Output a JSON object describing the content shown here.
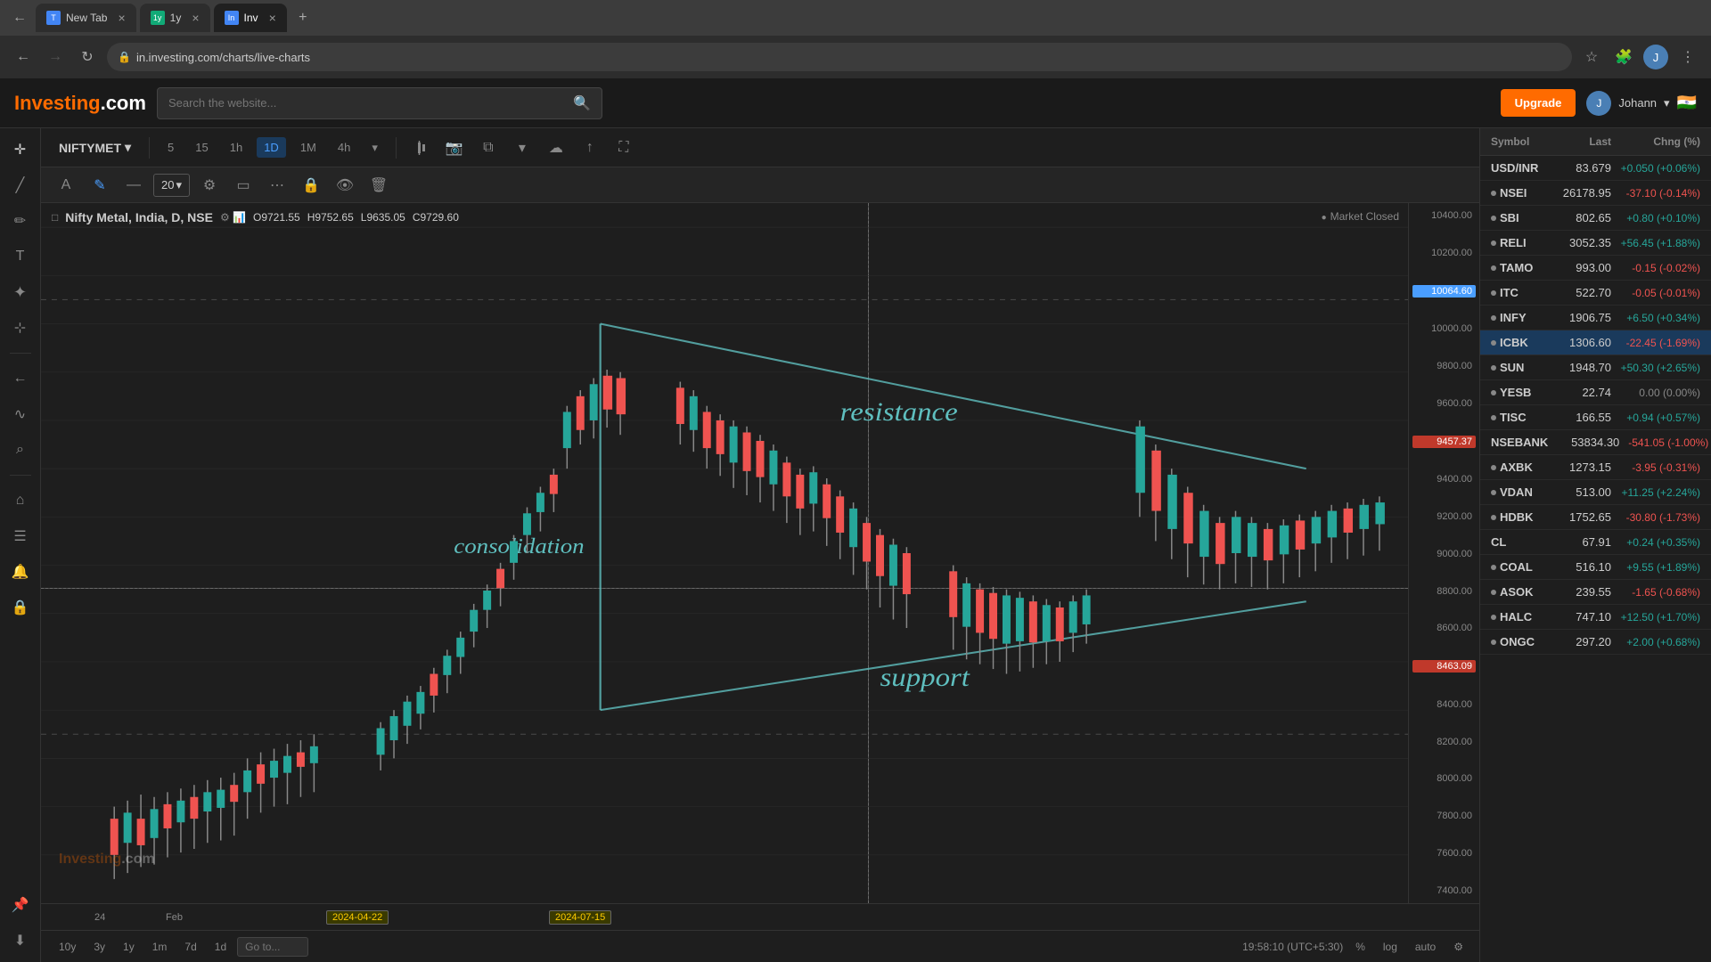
{
  "browser": {
    "tabs": [
      {
        "id": "tab1",
        "label": "Inv",
        "icon": "I",
        "active": false
      },
      {
        "id": "tab2",
        "label": "Inv",
        "icon": "I",
        "active": true
      }
    ],
    "address": "in.investing.com/charts/live-charts",
    "new_tab_label": "+"
  },
  "header": {
    "logo_text": "Investing",
    "logo_suffix": ".com",
    "search_placeholder": "Search the website...",
    "upgrade_label": "Upgrade",
    "user_name": "Johann",
    "flag": "🇮🇳"
  },
  "chart_toolbar": {
    "symbol": "NIFTYMET",
    "time_options": [
      "5",
      "15",
      "1h",
      "1D",
      "1M",
      "4h"
    ],
    "active_time": "1D"
  },
  "drawing_toolbar": {
    "font_size": "20",
    "tools": [
      "text",
      "pen",
      "line",
      "settings",
      "rect",
      "marker",
      "lock",
      "eye",
      "delete"
    ]
  },
  "chart_info": {
    "title": "Nifty Metal, India, D, NSE",
    "open": "O9721.55",
    "high": "H9752.65",
    "low": "L9635.05",
    "close": "C9729.60",
    "market_status": "Market Closed"
  },
  "price_levels": {
    "p1": "10400.00",
    "p2": "10200.00",
    "p3": "10064.60",
    "p4": "10000.00",
    "p5": "9800.00",
    "p6": "9600.00",
    "p7": "9457.37",
    "p8": "9400.00",
    "p9": "9200.00",
    "p10": "9000.00",
    "p11": "8800.00",
    "p12": "8600.00",
    "p13": "8463.09",
    "p14": "8400.00",
    "p15": "8200.00",
    "p16": "8000.00",
    "p17": "7800.00",
    "p18": "7600.00",
    "p19": "7400.00"
  },
  "annotations": {
    "resistance": "resistance",
    "support": "support",
    "consolidation": "consolidation"
  },
  "time_axis": {
    "labels": [
      "24",
      "Feb",
      "2024-04-22",
      "2024-07-15"
    ],
    "date1": "2024-04-22",
    "date2": "2024-07-15"
  },
  "bottom_nav": {
    "periods": [
      "10y",
      "3y",
      "1y",
      "1m",
      "7d",
      "1d"
    ],
    "goto_placeholder": "Go to...",
    "time_display": "19:58:10 (UTC+5:30)",
    "percent_label": "%",
    "log_label": "log",
    "auto_label": "auto",
    "settings_icon": "⚙"
  },
  "watchlist": {
    "headers": [
      "Symbol",
      "Last",
      "Chng (%)"
    ],
    "items": [
      {
        "symbol": "USD/INR",
        "last": "83.679",
        "change": "+0.050 (+0.06%)",
        "direction": "positive"
      },
      {
        "symbol": "NSEI",
        "last": "26178.95",
        "change": "-37.10 (-0.14%)",
        "direction": "negative",
        "dot": true
      },
      {
        "symbol": "SBI",
        "last": "802.65",
        "change": "+0.80 (+0.10%)",
        "direction": "positive",
        "dot": true
      },
      {
        "symbol": "RELI",
        "last": "3052.35",
        "change": "+56.45 (+1.88%)",
        "direction": "positive",
        "dot": true
      },
      {
        "symbol": "TAMO",
        "last": "993.00",
        "change": "-0.15 (-0.02%)",
        "direction": "negative",
        "dot": true
      },
      {
        "symbol": "ITC",
        "last": "522.70",
        "change": "-0.05 (-0.01%)",
        "direction": "negative",
        "dot": true
      },
      {
        "symbol": "INFY",
        "last": "1906.75",
        "change": "+6.50 (+0.34%)",
        "direction": "positive",
        "dot": true
      },
      {
        "symbol": "ICBK",
        "last": "1306.60",
        "change": "-22.45 (-1.69%)",
        "direction": "negative",
        "dot": true
      },
      {
        "symbol": "SUN",
        "last": "1948.70",
        "change": "+50.30 (+2.65%)",
        "direction": "positive",
        "dot": true
      },
      {
        "symbol": "YESB",
        "last": "22.74",
        "change": "0.00 (0.00%)",
        "direction": "neutral",
        "dot": true
      },
      {
        "symbol": "TISC",
        "last": "166.55",
        "change": "+0.94 (+0.57%)",
        "direction": "positive",
        "dot": true
      },
      {
        "symbol": "NSEBANK",
        "last": "53834.30",
        "change": "-541.05 (-1.00%)",
        "direction": "negative"
      },
      {
        "symbol": "AXBK",
        "last": "1273.15",
        "change": "-3.95 (-0.31%)",
        "direction": "negative",
        "dot": true
      },
      {
        "symbol": "VDAN",
        "last": "513.00",
        "change": "+11.25 (+2.24%)",
        "direction": "positive",
        "dot": true
      },
      {
        "symbol": "HDBK",
        "last": "1752.65",
        "change": "-30.80 (-1.73%)",
        "direction": "negative",
        "dot": true
      },
      {
        "symbol": "CL",
        "last": "67.91",
        "change": "+0.24 (+0.35%)",
        "direction": "positive"
      },
      {
        "symbol": "COAL",
        "last": "516.10",
        "change": "+9.55 (+1.89%)",
        "direction": "positive",
        "dot": true
      },
      {
        "symbol": "ASOK",
        "last": "239.55",
        "change": "-1.65 (-0.68%)",
        "direction": "negative",
        "dot": true
      },
      {
        "symbol": "HALC",
        "last": "747.10",
        "change": "+12.50 (+1.70%)",
        "direction": "positive",
        "dot": true
      },
      {
        "symbol": "ONGC",
        "last": "297.20",
        "change": "+2.00 (+0.68%)",
        "direction": "positive",
        "dot": true
      }
    ]
  },
  "left_sidebar": {
    "tools": [
      {
        "id": "crosshair",
        "icon": "+",
        "label": "crosshair"
      },
      {
        "id": "draw-line",
        "icon": "╱",
        "label": "draw-line"
      },
      {
        "id": "draw-tools",
        "icon": "✏",
        "label": "draw-tools"
      },
      {
        "id": "text-tool",
        "icon": "T",
        "label": "text-tool"
      },
      {
        "id": "more-tools",
        "icon": "⊕",
        "label": "more-tools"
      },
      {
        "id": "templates",
        "icon": "≡",
        "label": "templates"
      },
      {
        "id": "back",
        "icon": "←",
        "label": "back"
      },
      {
        "id": "indicators",
        "icon": "∿",
        "label": "indicators"
      },
      {
        "id": "zoom",
        "icon": "⌕",
        "label": "zoom"
      },
      {
        "id": "home",
        "icon": "⌂",
        "label": "home"
      },
      {
        "id": "watchlist-toggle",
        "icon": "☰",
        "label": "watchlist-toggle"
      },
      {
        "id": "alerts",
        "icon": "🔔",
        "label": "alerts"
      },
      {
        "id": "lock",
        "icon": "🔒",
        "label": "lock"
      },
      {
        "id": "pin",
        "icon": "📌",
        "label": "pin"
      },
      {
        "id": "bottom-toggle",
        "icon": "⬇",
        "label": "bottom-toggle"
      }
    ]
  }
}
